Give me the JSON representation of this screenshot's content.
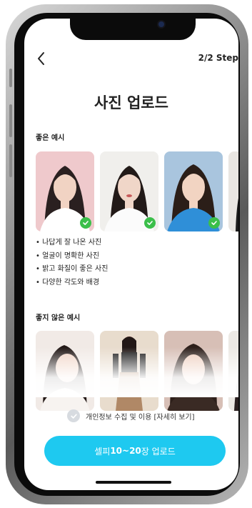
{
  "header": {
    "step_text": "2/2 Step"
  },
  "page": {
    "title": "사진 업로드"
  },
  "good_examples": {
    "label": "좋은 예시",
    "photos": [
      {
        "name": "good-photo-1"
      },
      {
        "name": "good-photo-2"
      },
      {
        "name": "good-photo-3"
      },
      {
        "name": "good-photo-4-partial"
      }
    ],
    "tips": [
      "나답게 잘 나온 사진",
      "얼굴이 명확한 사진",
      "밝고 화질이 좋은 사진",
      "다양한 각도와 배경"
    ]
  },
  "bad_examples": {
    "label": "좋지 않은 예시"
  },
  "consent": {
    "text": "개인정보 수집 및 이용 [자세히 보기]"
  },
  "cta": {
    "prefix": "셀피 ",
    "bold": "10~20",
    "suffix": "장 업로드"
  },
  "colors": {
    "accent": "#1ec9f0",
    "check": "#3bbf4a",
    "consent_check": "#d7dbe0"
  },
  "icons": {
    "back": "chevron-left-icon",
    "check": "check-icon"
  }
}
